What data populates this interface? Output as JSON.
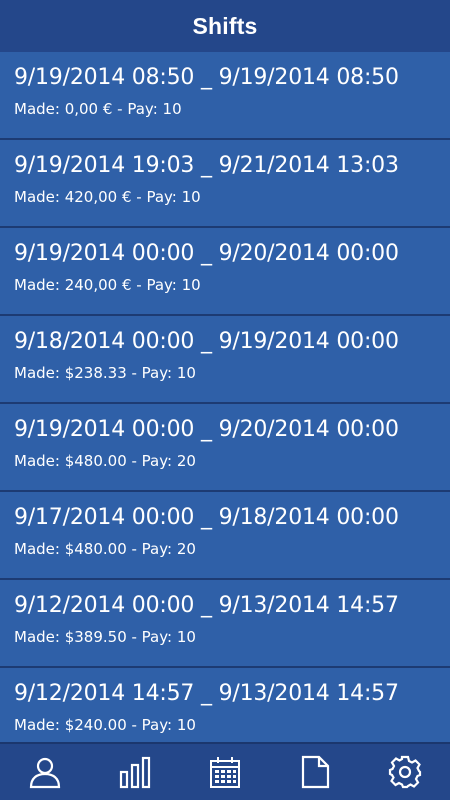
{
  "header": {
    "title": "Shifts"
  },
  "shifts": [
    {
      "range": "9/19/2014 08:50 _ 9/19/2014 08:50",
      "summary": "Made: 0,00 € - Pay: 10"
    },
    {
      "range": "9/19/2014 19:03 _ 9/21/2014 13:03",
      "summary": "Made: 420,00 € - Pay: 10"
    },
    {
      "range": "9/19/2014 00:00 _ 9/20/2014 00:00",
      "summary": "Made: 240,00 € - Pay: 10"
    },
    {
      "range": "9/18/2014 00:00 _ 9/19/2014 00:00",
      "summary": "Made: $238.33 - Pay: 10"
    },
    {
      "range": "9/19/2014 00:00 _ 9/20/2014 00:00",
      "summary": "Made: $480.00 - Pay: 20"
    },
    {
      "range": "9/17/2014 00:00 _ 9/18/2014 00:00",
      "summary": "Made: $480.00 - Pay: 20"
    },
    {
      "range": "9/12/2014 00:00 _ 9/13/2014 14:57",
      "summary": "Made: $389.50 - Pay: 10"
    },
    {
      "range": "9/12/2014 14:57 _ 9/13/2014 14:57",
      "summary": "Made: $240.00 - Pay: 10"
    }
  ],
  "navbar": {
    "items": [
      {
        "icon": "person-icon"
      },
      {
        "icon": "bar-chart-icon"
      },
      {
        "icon": "calendar-icon"
      },
      {
        "icon": "document-icon"
      },
      {
        "icon": "gear-icon"
      }
    ]
  },
  "colors": {
    "header_bg": "#24478a",
    "list_item_bg": "#2f60a8",
    "divider": "#1d3b73",
    "text": "#ffffff"
  }
}
